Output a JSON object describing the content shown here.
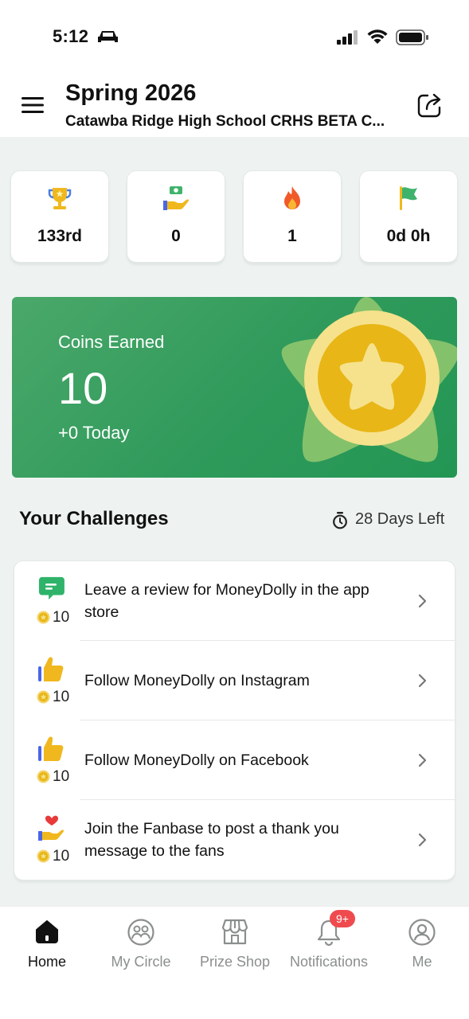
{
  "status_bar": {
    "time": "5:12"
  },
  "header": {
    "title": "Spring 2026",
    "subtitle": "Catawba Ridge High School CRHS BETA C..."
  },
  "stats": [
    {
      "icon": "trophy-icon",
      "value": "133rd"
    },
    {
      "icon": "donation-hand-icon",
      "value": "0"
    },
    {
      "icon": "flame-icon",
      "value": "1"
    },
    {
      "icon": "flag-icon",
      "value": "0d 0h"
    }
  ],
  "coins_card": {
    "label": "Coins Earned",
    "value": "10",
    "today": "+0 Today"
  },
  "challenges": {
    "title": "Your Challenges",
    "days_left": "28 Days Left",
    "items": [
      {
        "icon": "message-icon",
        "points": "10",
        "text": "Leave a review for MoneyDolly in the app store"
      },
      {
        "icon": "thumbs-up-icon",
        "points": "10",
        "text": "Follow MoneyDolly on Instagram"
      },
      {
        "icon": "thumbs-up-icon",
        "points": "10",
        "text": "Follow MoneyDolly on Facebook"
      },
      {
        "icon": "heart-hand-icon",
        "points": "10",
        "text": "Join the Fanbase to post a thank you message to the fans"
      }
    ]
  },
  "tabs": [
    {
      "label": "Home",
      "icon": "home-icon",
      "active": true
    },
    {
      "label": "My Circle",
      "icon": "circle-people-icon",
      "active": false
    },
    {
      "label": "Prize Shop",
      "icon": "shop-icon",
      "active": false
    },
    {
      "label": "Notifications",
      "icon": "bell-icon",
      "active": false,
      "badge": "9+"
    },
    {
      "label": "Me",
      "icon": "profile-icon",
      "active": false
    }
  ],
  "colors": {
    "primary_green": "#2f9a5b",
    "background": "#eef3f2",
    "badge_red": "#ef4b4f",
    "coin_gold": "#e8b617"
  }
}
